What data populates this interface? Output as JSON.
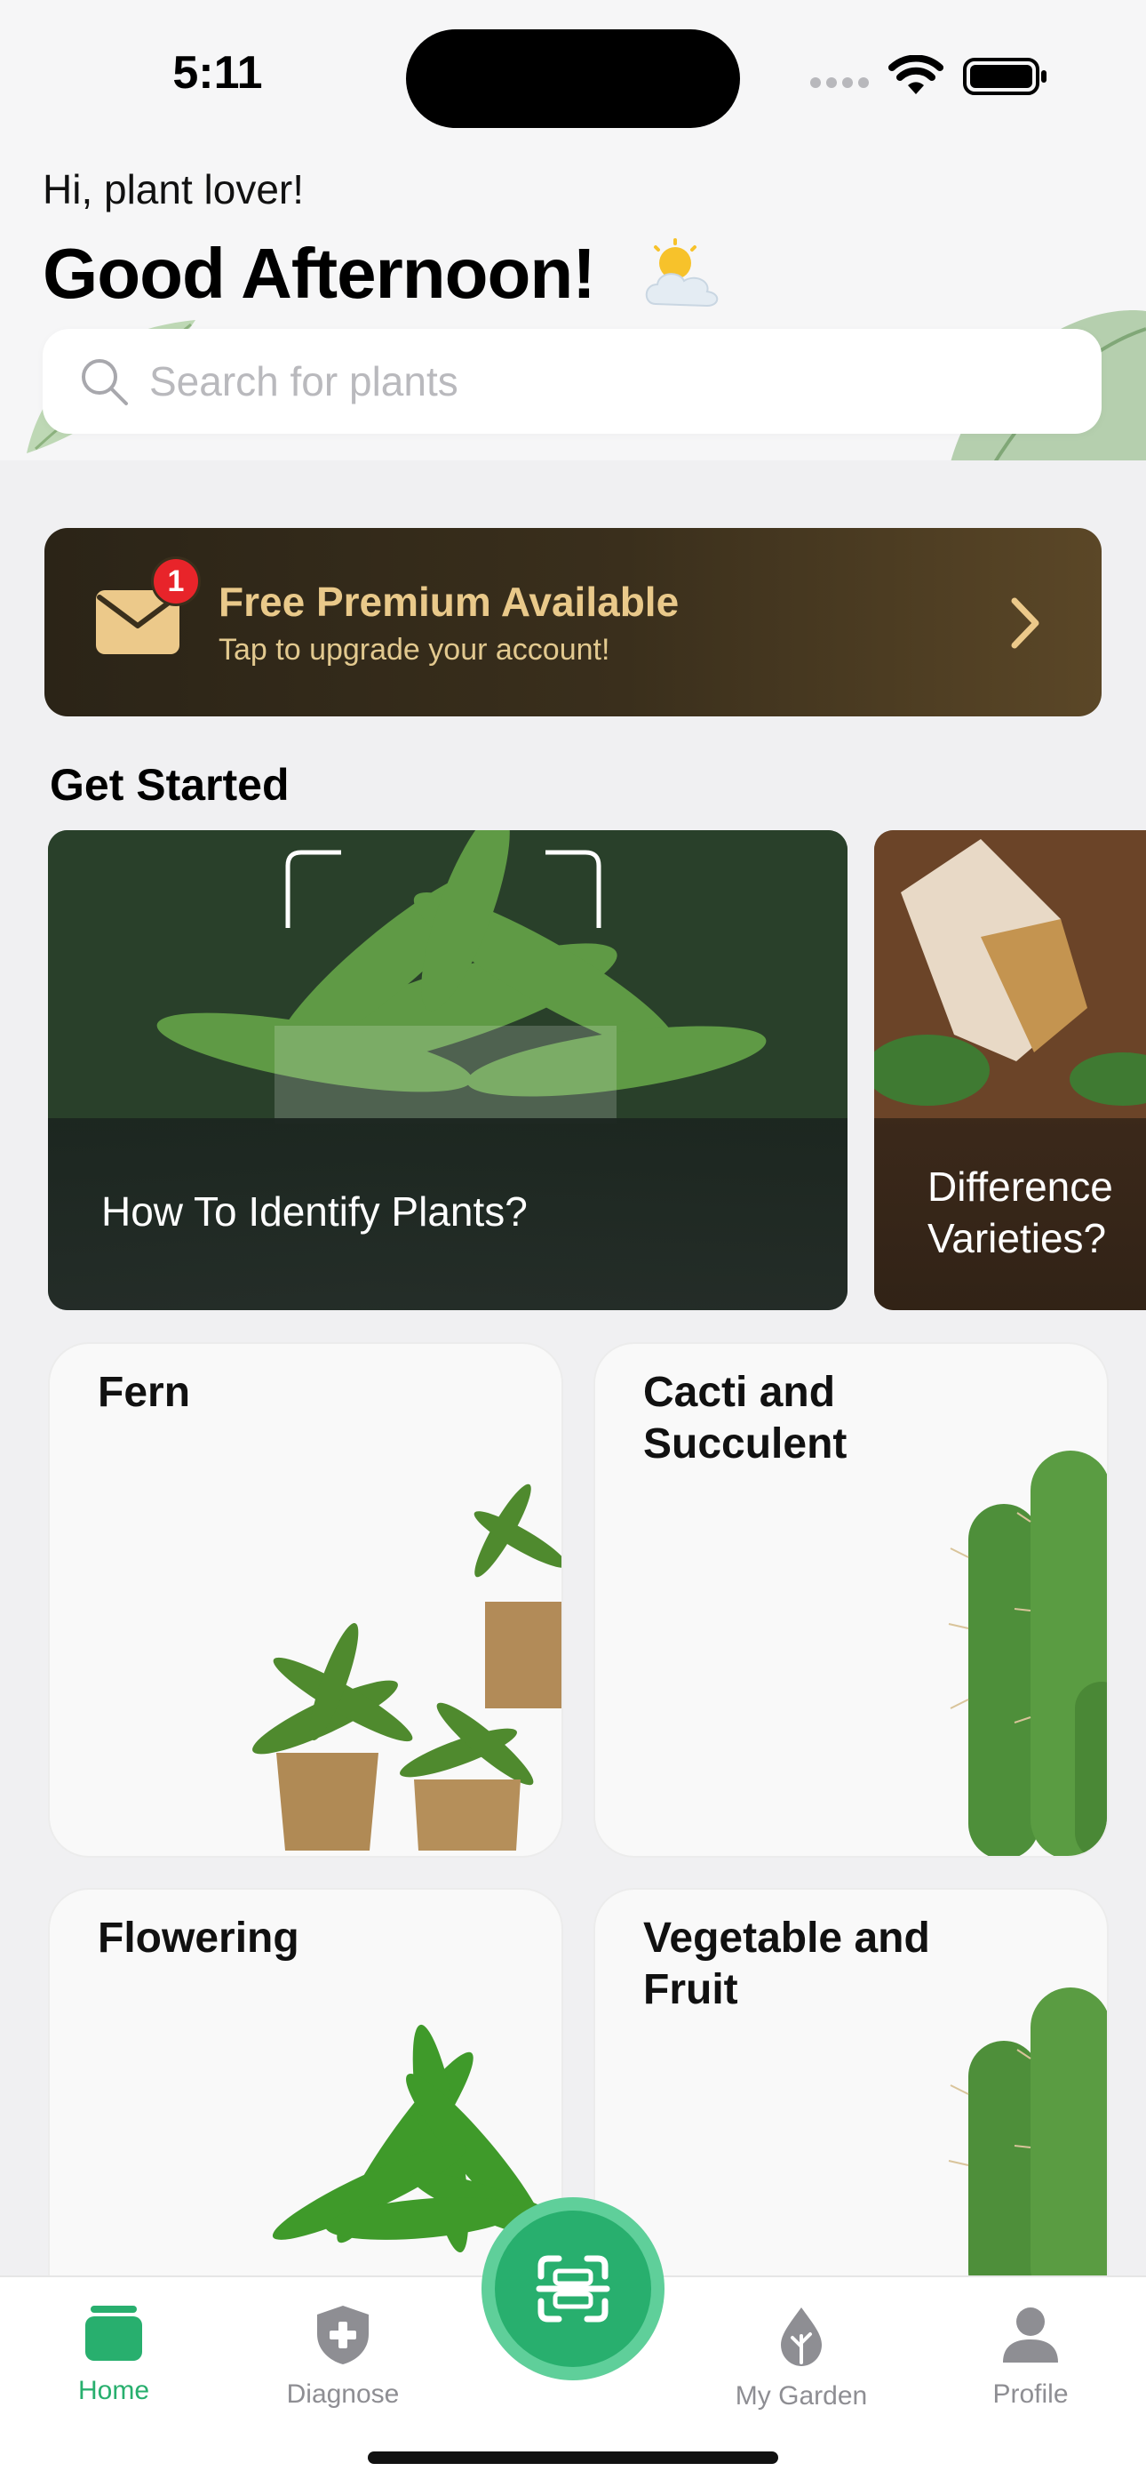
{
  "status_bar": {
    "time": "5:11"
  },
  "header": {
    "greeting": "Hi, plant lover!",
    "title": "Good Afternoon!",
    "weather_icon": "sun-behind-cloud-icon"
  },
  "search": {
    "placeholder": "Search for plants",
    "icon": "search-icon"
  },
  "premium": {
    "badge_count": "1",
    "title": "Free Premium Available",
    "subtitle": "Tap to upgrade your account!",
    "accent": "#e9c98a"
  },
  "get_started": {
    "title": "Get Started",
    "cards": [
      {
        "line1": "How To Identify Plants?",
        "line2": ""
      },
      {
        "line1": "Difference",
        "line2": "Varieties?"
      }
    ]
  },
  "categories": [
    {
      "line1": "Fern",
      "line2": ""
    },
    {
      "line1": "Cacti and",
      "line2": "Succulent"
    },
    {
      "line1": "Flowering",
      "line2": ""
    },
    {
      "line1": "Vegetable and",
      "line2": "Fruit"
    }
  ],
  "tabbar": {
    "tabs": [
      {
        "label": "Home",
        "icon": "home-icon",
        "active": true
      },
      {
        "label": "Diagnose",
        "icon": "shield-plus-icon",
        "active": false
      },
      {
        "label": "My Garden",
        "icon": "plant-drop-icon",
        "active": false
      },
      {
        "label": "Profile",
        "icon": "person-icon",
        "active": false
      }
    ],
    "scan_icon": "scan-icon",
    "accent": "#28af6e"
  }
}
